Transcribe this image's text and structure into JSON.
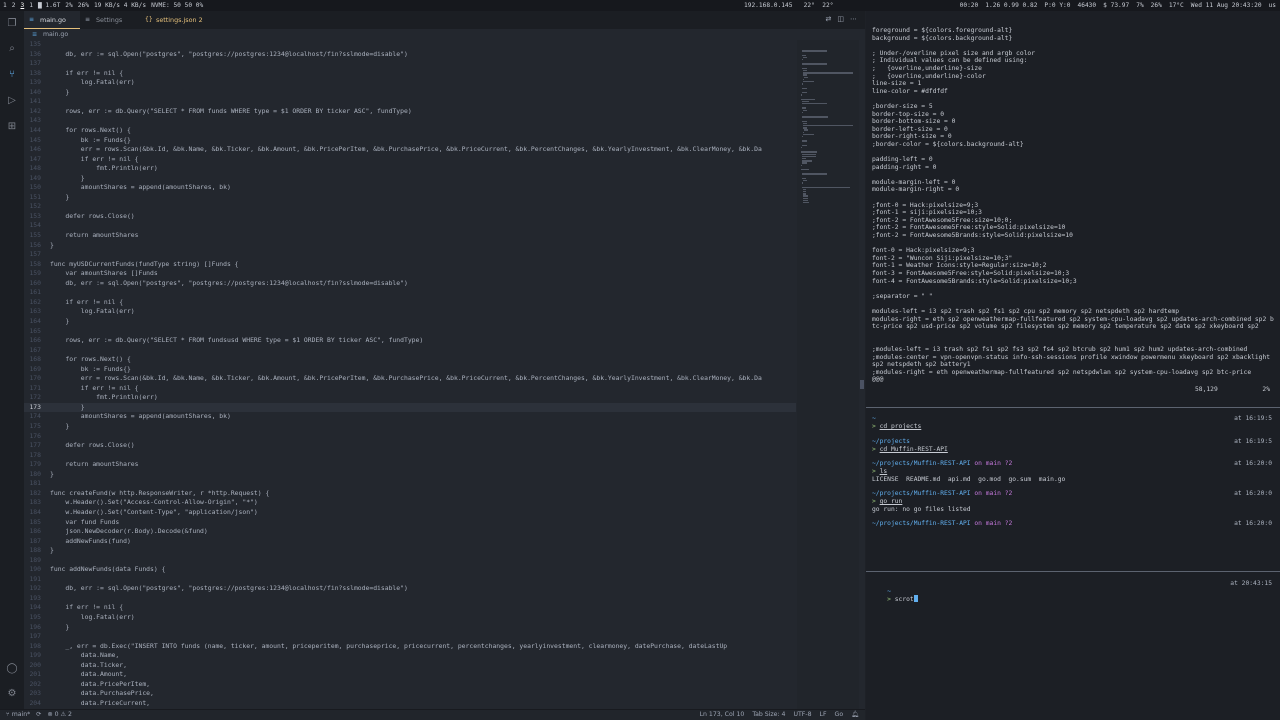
{
  "topbar": {
    "workspaces": [
      "1",
      "2",
      "3"
    ],
    "left_items": [
      "1",
      "1.6T",
      "2%",
      "26%",
      "19 KB/s 4 KB/s",
      "NVME: 50 50 0%"
    ],
    "ip": "192.168.0.145",
    "weather_items": [
      "22°",
      "22°"
    ],
    "right_items": [
      "00:20",
      "1.26 0.99 0.82",
      "P:0 Y:0",
      "46430",
      "$ 73.97",
      "7%",
      "26%",
      "17°C",
      "Wed 11 Aug 20:43:20",
      "us"
    ]
  },
  "vscode": {
    "tabs": [
      {
        "label": "main.go",
        "active": true
      },
      {
        "label": "Settings",
        "active": false
      },
      {
        "label": "settings.json 2",
        "active": false
      }
    ],
    "breadcrumb": "main.go",
    "code_lines": [
      {
        "n": "135",
        "t": ""
      },
      {
        "n": "136",
        "t": "    db, err := sql.Open(\"postgres\", \"postgres://postgres:1234@localhost/fin?sslmode=disable\")"
      },
      {
        "n": "137",
        "t": ""
      },
      {
        "n": "138",
        "t": "    if err != nil {"
      },
      {
        "n": "139",
        "t": "        log.Fatal(err)"
      },
      {
        "n": "140",
        "t": "    }"
      },
      {
        "n": "141",
        "t": ""
      },
      {
        "n": "142",
        "t": "    rows, err := db.Query(\"SELECT * FROM funds WHERE type = $1 ORDER BY ticker ASC\", fundType)"
      },
      {
        "n": "143",
        "t": ""
      },
      {
        "n": "144",
        "t": "    for rows.Next() {"
      },
      {
        "n": "145",
        "t": "        bk := Funds{}"
      },
      {
        "n": "146",
        "t": "        err = rows.Scan(&bk.Id, &bk.Name, &bk.Ticker, &bk.Amount, &bk.PricePerItem, &bk.PurchasePrice, &bk.PriceCurrent, &bk.PercentChanges, &bk.YearlyInvestment, &bk.ClearMoney, &bk.Da"
      },
      {
        "n": "147",
        "t": "        if err != nil {"
      },
      {
        "n": "148",
        "t": "            fmt.Println(err)"
      },
      {
        "n": "149",
        "t": "        }"
      },
      {
        "n": "150",
        "t": "        amountShares = append(amountShares, bk)"
      },
      {
        "n": "151",
        "t": "    }"
      },
      {
        "n": "152",
        "t": ""
      },
      {
        "n": "153",
        "t": "    defer rows.Close()"
      },
      {
        "n": "154",
        "t": ""
      },
      {
        "n": "155",
        "t": "    return amountShares"
      },
      {
        "n": "156",
        "t": "}"
      },
      {
        "n": "157",
        "t": ""
      },
      {
        "n": "158",
        "t": "func myUSDCurrentFunds(fundType string) []Funds {"
      },
      {
        "n": "159",
        "t": "    var amountShares []Funds"
      },
      {
        "n": "160",
        "t": "    db, err := sql.Open(\"postgres\", \"postgres://postgres:1234@localhost/fin?sslmode=disable\")"
      },
      {
        "n": "161",
        "t": ""
      },
      {
        "n": "162",
        "t": "    if err != nil {"
      },
      {
        "n": "163",
        "t": "        log.Fatal(err)"
      },
      {
        "n": "164",
        "t": "    }"
      },
      {
        "n": "165",
        "t": ""
      },
      {
        "n": "166",
        "t": "    rows, err := db.Query(\"SELECT * FROM fundsusd WHERE type = $1 ORDER BY ticker ASC\", fundType)"
      },
      {
        "n": "167",
        "t": ""
      },
      {
        "n": "168",
        "t": "    for rows.Next() {"
      },
      {
        "n": "169",
        "t": "        bk := Funds{}"
      },
      {
        "n": "170",
        "t": "        err = rows.Scan(&bk.Id, &bk.Name, &bk.Ticker, &bk.Amount, &bk.PricePerItem, &bk.PurchasePrice, &bk.PriceCurrent, &bk.PercentChanges, &bk.YearlyInvestment, &bk.ClearMoney, &bk.Da"
      },
      {
        "n": "171",
        "t": "        if err != nil {"
      },
      {
        "n": "172",
        "t": "            fmt.Println(err)"
      },
      {
        "n": "173",
        "t": "        }"
      },
      {
        "n": "174",
        "t": "        amountShares = append(amountShares, bk)"
      },
      {
        "n": "175",
        "t": "    }"
      },
      {
        "n": "176",
        "t": ""
      },
      {
        "n": "177",
        "t": "    defer rows.Close()"
      },
      {
        "n": "178",
        "t": ""
      },
      {
        "n": "179",
        "t": "    return amountShares"
      },
      {
        "n": "180",
        "t": "}"
      },
      {
        "n": "181",
        "t": ""
      },
      {
        "n": "182",
        "t": "func createFund(w http.ResponseWriter, r *http.Request) {"
      },
      {
        "n": "183",
        "t": "    w.Header().Set(\"Access-Control-Allow-Origin\", \"*\")"
      },
      {
        "n": "184",
        "t": "    w.Header().Set(\"Content-Type\", \"application/json\")"
      },
      {
        "n": "185",
        "t": "    var fund Funds"
      },
      {
        "n": "186",
        "t": "    json.NewDecoder(r.Body).Decode(&fund)"
      },
      {
        "n": "187",
        "t": "    addNewFunds(fund)"
      },
      {
        "n": "188",
        "t": "}"
      },
      {
        "n": "189",
        "t": ""
      },
      {
        "n": "190",
        "t": "func addNewFunds(data Funds) {"
      },
      {
        "n": "191",
        "t": ""
      },
      {
        "n": "192",
        "t": "    db, err := sql.Open(\"postgres\", \"postgres://postgres:1234@localhost/fin?sslmode=disable\")"
      },
      {
        "n": "193",
        "t": ""
      },
      {
        "n": "194",
        "t": "    if err != nil {"
      },
      {
        "n": "195",
        "t": "        log.Fatal(err)"
      },
      {
        "n": "196",
        "t": "    }"
      },
      {
        "n": "197",
        "t": ""
      },
      {
        "n": "198",
        "t": "    _, err = db.Exec(\"INSERT INTO funds (name, ticker, amount, priceperitem, purchaseprice, pricecurrent, percentchanges, yearlyinvestment, clearmoney, datePurchase, dateLastUp"
      },
      {
        "n": "199",
        "t": "        data.Name,"
      },
      {
        "n": "200",
        "t": "        data.Ticker,"
      },
      {
        "n": "201",
        "t": "        data.Amount,"
      },
      {
        "n": "202",
        "t": "        data.PricePerItem,"
      },
      {
        "n": "203",
        "t": "        data.PurchasePrice,"
      },
      {
        "n": "204",
        "t": "        data.PriceCurrent,"
      },
      {
        "n": "205",
        "t": "        data.PercentChanges,"
      }
    ],
    "cursor_line": "173",
    "status": {
      "branch": "main*",
      "problems": "0 ⚠ 2",
      "position": "Ln 173, Col 10",
      "tab_size": "Tab Size: 4",
      "encoding": "UTF-8",
      "eol": "LF",
      "language": "Go"
    }
  },
  "vim": {
    "lines": [
      "foreground = ${colors.foreground-alt}",
      "background = ${colors.background-alt}",
      "",
      "; Under-/overline pixel size and argb color",
      "; Individual values can be defined using:",
      ";   {overline,underline}-size",
      ";   {overline,underline}-color",
      "line-size = 1",
      "line-color = #dfdfdf",
      "",
      ";border-size = 5",
      "border-top-size = 0",
      "border-bottom-size = 0",
      "border-left-size = 0",
      "border-right-size = 0",
      ";border-color = ${colors.background-alt}",
      "",
      "padding-left = 0",
      "padding-right = 0",
      "",
      "module-margin-left = 0",
      "module-margin-right = 0",
      "",
      ";font-0 = Hack:pixelsize=9;3",
      ";font-1 = siji:pixelsize=10;3",
      ";font-2 = FontAwesome5Free:size=10;0;",
      ";font-2 = FontAwesome5Free:style=Solid:pixelsize=10",
      ";font-2 = FontAwesome5Brands:style=Solid:pixelsize=10",
      "",
      "font-0 = Hack:pixelsize=9;3",
      "font-2 = \"Wuncon Siji:pixelsize=10;3\"",
      "font-1 = Weather Icons:style=Regular:size=10;2",
      "font-3 = FontAwesome5Free:style=Solid:pixelsize=10;3",
      "font-4 = FontAwesome5Brands:style=Solid:pixelsize=10;3",
      "",
      ";separator = \" \"",
      "",
      "modules-left = i3 sp2 trash sp2 fs1 sp2 cpu sp2 memory sp2 netspdeth sp2 hardtemp",
      "modules-right = eth sp2 openweathermap-fullfeatured sp2 system-cpu-loadavg sp2 updates-arch-combined sp2 btc-price sp2 usd-price sp2 volume sp2 filesystem sp2 memory sp2 temperature sp2 date sp2 xkeyboard sp2",
      "",
      "",
      ";modules-left = i3 trash sp2 fs1 sp2 fs3 sp2 fs4 sp2 btcrub sp2 hum1 sp2 hum2 updates-arch-combined",
      ";modules-center = vpn-openvpn-status info-ssh-sessions profile xwindow powermenu xkeyboard sp2 xbacklight sp2 netspdeth sp2 battery1",
      ";modules-right = eth openweathermap-fullfeatured sp2 netspdwlan sp2 system-cpu-loadavg sp2 btc-price",
      "@@@"
    ],
    "position": "58,129",
    "percent": "2%"
  },
  "shell": {
    "entries": [
      {
        "path": "~",
        "branch": "",
        "time": "at 16:19:5",
        "cmd": "cd projects",
        "output": ""
      },
      {
        "path": "~/projects",
        "branch": "",
        "time": "at 16:19:5",
        "cmd": "cd Muffin-REST-API",
        "output": ""
      },
      {
        "path": "~/projects/Muffin-REST-API",
        "branch": "on main ?2",
        "time": "at 16:20:0",
        "cmd": "ls",
        "output": "LICENSE  README.md  api.md  go.mod  go.sum  main.go"
      },
      {
        "path": "~/projects/Muffin-REST-API",
        "branch": "on main ?2",
        "time": "at 16:20:0",
        "cmd": "go run",
        "output": "go run: no go files listed"
      },
      {
        "path": "~/projects/Muffin-REST-API",
        "branch": "on main ?2",
        "time": "at 16:20:0",
        "cmd": "",
        "output": ""
      }
    ]
  },
  "shell2": {
    "path": "~",
    "time": "at 20:43:15",
    "cmd": "scrot"
  }
}
